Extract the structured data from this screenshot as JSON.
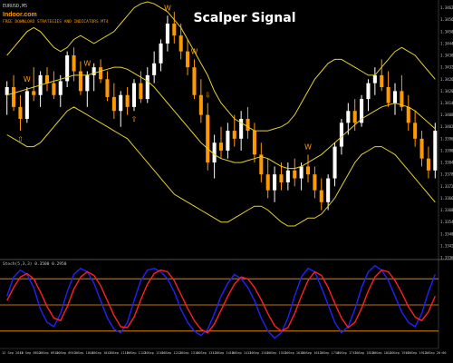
{
  "header": {
    "symbol_line": "EURUSD,M5",
    "brand": "Indoor.com",
    "subtitle": "FREE DOWNLOAD STRATEGIES AND INDICATORS MT4",
    "watermark": "Scalper Signal"
  },
  "indicator": {
    "label": "Stoch(5,3,3) 0.3500 0.2950"
  },
  "colors": {
    "background": "#000000",
    "bull_candle": "#ffffff",
    "bear_candle": "#ff9900",
    "band": "#e6cf2f",
    "arrow_label": "#ff9900",
    "signal_up": "#22cc22",
    "stoch_main": "#2222ff",
    "stoch_signal": "#ff2020",
    "stoch_level": "#ff9900",
    "axis_text": "#c8c8c8"
  },
  "chart_data": {
    "type": "candlestick",
    "price_axis_labels": [
      "1.3462",
      "1.3456",
      "1.3450",
      "1.3444",
      "1.3438",
      "1.3432",
      "1.3426",
      "1.3420",
      "1.3414",
      "1.3408",
      "1.3402",
      "1.3396",
      "1.3390",
      "1.3384",
      "1.3378",
      "1.3372",
      "1.3366",
      "1.3360",
      "1.3354",
      "1.3348",
      "1.3342",
      "1.3336"
    ],
    "time_axis_labels": [
      "12 Sep 2016",
      "12 Sep 08:30",
      "12 Sep 09:00",
      "12 Sep 09:30",
      "12 Sep 10:00",
      "12 Sep 10:30",
      "12 Sep 11:00",
      "12 Sep 11:30",
      "12 Sep 12:00",
      "12 Sep 12:30",
      "12 Sep 13:00",
      "12 Sep 13:30",
      "12 Sep 14:00",
      "12 Sep 14:30",
      "12 Sep 15:00",
      "12 Sep 15:30",
      "12 Sep 16:00",
      "12 Sep 16:30",
      "12 Sep 17:00",
      "12 Sep 17:30",
      "12 Sep 18:00",
      "12 Sep 18:30",
      "12 Sep 19:00",
      "12 Sep 19:30",
      "12 Sep 20:00"
    ],
    "price_range": [
      1.3336,
      1.3465
    ],
    "candles": [
      {
        "o": 1.3418,
        "h": 1.3425,
        "l": 1.3408,
        "c": 1.3422
      },
      {
        "o": 1.3422,
        "h": 1.3428,
        "l": 1.341,
        "c": 1.3412
      },
      {
        "o": 1.3412,
        "h": 1.3418,
        "l": 1.34,
        "c": 1.3406
      },
      {
        "o": 1.3406,
        "h": 1.3422,
        "l": 1.3404,
        "c": 1.342
      },
      {
        "o": 1.342,
        "h": 1.3432,
        "l": 1.3415,
        "c": 1.3418
      },
      {
        "o": 1.3418,
        "h": 1.343,
        "l": 1.3412,
        "c": 1.3428
      },
      {
        "o": 1.3428,
        "h": 1.3432,
        "l": 1.342,
        "c": 1.3424
      },
      {
        "o": 1.3424,
        "h": 1.343,
        "l": 1.3416,
        "c": 1.3418
      },
      {
        "o": 1.3418,
        "h": 1.3428,
        "l": 1.3412,
        "c": 1.3425
      },
      {
        "o": 1.3425,
        "h": 1.344,
        "l": 1.3422,
        "c": 1.3438
      },
      {
        "o": 1.3438,
        "h": 1.3442,
        "l": 1.3425,
        "c": 1.343
      },
      {
        "o": 1.343,
        "h": 1.3435,
        "l": 1.3418,
        "c": 1.342
      },
      {
        "o": 1.342,
        "h": 1.343,
        "l": 1.3412,
        "c": 1.3428
      },
      {
        "o": 1.3428,
        "h": 1.3434,
        "l": 1.342,
        "c": 1.3432
      },
      {
        "o": 1.3432,
        "h": 1.3436,
        "l": 1.3424,
        "c": 1.3426
      },
      {
        "o": 1.3426,
        "h": 1.343,
        "l": 1.3415,
        "c": 1.3417
      },
      {
        "o": 1.3417,
        "h": 1.3424,
        "l": 1.3406,
        "c": 1.341
      },
      {
        "o": 1.341,
        "h": 1.342,
        "l": 1.3402,
        "c": 1.3418
      },
      {
        "o": 1.3418,
        "h": 1.3422,
        "l": 1.3408,
        "c": 1.3412
      },
      {
        "o": 1.3412,
        "h": 1.3426,
        "l": 1.341,
        "c": 1.3424
      },
      {
        "o": 1.3424,
        "h": 1.343,
        "l": 1.3414,
        "c": 1.3416
      },
      {
        "o": 1.3416,
        "h": 1.3432,
        "l": 1.3414,
        "c": 1.3428
      },
      {
        "o": 1.3428,
        "h": 1.344,
        "l": 1.3424,
        "c": 1.3434
      },
      {
        "o": 1.3434,
        "h": 1.3446,
        "l": 1.343,
        "c": 1.3444
      },
      {
        "o": 1.3444,
        "h": 1.3458,
        "l": 1.344,
        "c": 1.3454
      },
      {
        "o": 1.3454,
        "h": 1.346,
        "l": 1.3444,
        "c": 1.3448
      },
      {
        "o": 1.3448,
        "h": 1.3454,
        "l": 1.3436,
        "c": 1.344
      },
      {
        "o": 1.344,
        "h": 1.3446,
        "l": 1.3428,
        "c": 1.3432
      },
      {
        "o": 1.3432,
        "h": 1.3436,
        "l": 1.3416,
        "c": 1.3418
      },
      {
        "o": 1.3418,
        "h": 1.3426,
        "l": 1.3404,
        "c": 1.3408
      },
      {
        "o": 1.3408,
        "h": 1.3414,
        "l": 1.338,
        "c": 1.3384
      },
      {
        "o": 1.3384,
        "h": 1.3398,
        "l": 1.3376,
        "c": 1.3394
      },
      {
        "o": 1.3394,
        "h": 1.3402,
        "l": 1.3386,
        "c": 1.339
      },
      {
        "o": 1.339,
        "h": 1.3404,
        "l": 1.3386,
        "c": 1.34
      },
      {
        "o": 1.34,
        "h": 1.3408,
        "l": 1.3392,
        "c": 1.3396
      },
      {
        "o": 1.3396,
        "h": 1.341,
        "l": 1.339,
        "c": 1.3406
      },
      {
        "o": 1.3406,
        "h": 1.3412,
        "l": 1.3396,
        "c": 1.34
      },
      {
        "o": 1.34,
        "h": 1.3404,
        "l": 1.3384,
        "c": 1.3388
      },
      {
        "o": 1.3388,
        "h": 1.3394,
        "l": 1.3374,
        "c": 1.3378
      },
      {
        "o": 1.3378,
        "h": 1.3386,
        "l": 1.3366,
        "c": 1.337
      },
      {
        "o": 1.337,
        "h": 1.3382,
        "l": 1.3364,
        "c": 1.3378
      },
      {
        "o": 1.3378,
        "h": 1.3384,
        "l": 1.337,
        "c": 1.3374
      },
      {
        "o": 1.3374,
        "h": 1.3384,
        "l": 1.337,
        "c": 1.338
      },
      {
        "o": 1.338,
        "h": 1.3386,
        "l": 1.3372,
        "c": 1.3376
      },
      {
        "o": 1.3376,
        "h": 1.3384,
        "l": 1.337,
        "c": 1.3382
      },
      {
        "o": 1.3382,
        "h": 1.3388,
        "l": 1.3374,
        "c": 1.3378
      },
      {
        "o": 1.3378,
        "h": 1.3382,
        "l": 1.3366,
        "c": 1.337
      },
      {
        "o": 1.337,
        "h": 1.3376,
        "l": 1.336,
        "c": 1.3364
      },
      {
        "o": 1.3364,
        "h": 1.3378,
        "l": 1.336,
        "c": 1.3376
      },
      {
        "o": 1.3376,
        "h": 1.3394,
        "l": 1.3372,
        "c": 1.3392
      },
      {
        "o": 1.3392,
        "h": 1.3406,
        "l": 1.3388,
        "c": 1.3404
      },
      {
        "o": 1.3404,
        "h": 1.3414,
        "l": 1.3398,
        "c": 1.341
      },
      {
        "o": 1.341,
        "h": 1.3416,
        "l": 1.34,
        "c": 1.3404
      },
      {
        "o": 1.3404,
        "h": 1.3418,
        "l": 1.3402,
        "c": 1.3416
      },
      {
        "o": 1.3416,
        "h": 1.3426,
        "l": 1.341,
        "c": 1.3424
      },
      {
        "o": 1.3424,
        "h": 1.3432,
        "l": 1.3418,
        "c": 1.3428
      },
      {
        "o": 1.3428,
        "h": 1.3436,
        "l": 1.342,
        "c": 1.3422
      },
      {
        "o": 1.3422,
        "h": 1.343,
        "l": 1.3412,
        "c": 1.3414
      },
      {
        "o": 1.3414,
        "h": 1.3424,
        "l": 1.3408,
        "c": 1.342
      },
      {
        "o": 1.342,
        "h": 1.3428,
        "l": 1.341,
        "c": 1.3412
      },
      {
        "o": 1.3412,
        "h": 1.3418,
        "l": 1.34,
        "c": 1.3404
      },
      {
        "o": 1.3404,
        "h": 1.341,
        "l": 1.3392,
        "c": 1.3396
      },
      {
        "o": 1.3396,
        "h": 1.34,
        "l": 1.3382,
        "c": 1.3386
      },
      {
        "o": 1.3386,
        "h": 1.3392,
        "l": 1.3376,
        "c": 1.338
      },
      {
        "o": 1.338,
        "h": 1.3404,
        "l": 1.3376,
        "c": 1.34
      }
    ],
    "bollinger": {
      "upper": [
        1.3438,
        1.3442,
        1.3446,
        1.345,
        1.3452,
        1.345,
        1.3446,
        1.3442,
        1.344,
        1.3442,
        1.3446,
        1.3448,
        1.3446,
        1.3444,
        1.3446,
        1.3448,
        1.345,
        1.3454,
        1.3458,
        1.3462,
        1.3464,
        1.3465,
        1.3464,
        1.3462,
        1.346,
        1.3456,
        1.3452,
        1.3446,
        1.344,
        1.3434,
        1.3428,
        1.342,
        1.3414,
        1.341,
        1.3406,
        1.3404,
        1.3402,
        1.34,
        1.34,
        1.34,
        1.3401,
        1.3402,
        1.3404,
        1.3408,
        1.3414,
        1.342,
        1.3426,
        1.343,
        1.3434,
        1.3436,
        1.3436,
        1.3434,
        1.3432,
        1.343,
        1.3428,
        1.3428,
        1.3432,
        1.3436,
        1.344,
        1.3442,
        1.344,
        1.3438,
        1.3434,
        1.343,
        1.3426
      ],
      "middle": [
        1.3418,
        1.3419,
        1.342,
        1.3421,
        1.3422,
        1.3423,
        1.3424,
        1.3425,
        1.3426,
        1.3427,
        1.3428,
        1.3428,
        1.3428,
        1.3429,
        1.343,
        1.3431,
        1.3432,
        1.3432,
        1.3431,
        1.3429,
        1.3427,
        1.3425,
        1.3422,
        1.3418,
        1.3414,
        1.341,
        1.3406,
        1.3402,
        1.3398,
        1.3394,
        1.3391,
        1.3388,
        1.3386,
        1.3385,
        1.3384,
        1.3384,
        1.3385,
        1.3386,
        1.3387,
        1.3386,
        1.3384,
        1.3382,
        1.3381,
        1.3381,
        1.3382,
        1.3384,
        1.3386,
        1.3388,
        1.3391,
        1.3394,
        1.3397,
        1.34,
        1.3403,
        1.3406,
        1.3408,
        1.341,
        1.3412,
        1.3413,
        1.3414,
        1.3413,
        1.3412,
        1.341,
        1.3407,
        1.3404,
        1.3401
      ],
      "lower": [
        1.3398,
        1.3396,
        1.3394,
        1.3392,
        1.3392,
        1.3394,
        1.3398,
        1.3402,
        1.3406,
        1.341,
        1.3412,
        1.341,
        1.3408,
        1.3406,
        1.3404,
        1.3402,
        1.34,
        1.3398,
        1.3396,
        1.3392,
        1.3388,
        1.3384,
        1.338,
        1.3376,
        1.3372,
        1.3368,
        1.3366,
        1.3364,
        1.3362,
        1.336,
        1.3358,
        1.3356,
        1.3354,
        1.3354,
        1.3356,
        1.3358,
        1.336,
        1.3362,
        1.3362,
        1.336,
        1.3357,
        1.3354,
        1.3352,
        1.3352,
        1.3354,
        1.3356,
        1.3356,
        1.3358,
        1.3362,
        1.3366,
        1.3372,
        1.3378,
        1.3384,
        1.3388,
        1.339,
        1.3392,
        1.3392,
        1.339,
        1.3388,
        1.3384,
        1.338,
        1.3376,
        1.3372,
        1.3368,
        1.3364
      ]
    },
    "signals": [
      {
        "index": 3,
        "label": "W",
        "kind": "down"
      },
      {
        "index": 12,
        "label": "W",
        "kind": "down"
      },
      {
        "index": 24,
        "label": "W",
        "kind": "down"
      },
      {
        "index": 28,
        "label": "W",
        "kind": "down"
      },
      {
        "index": 45,
        "label": "W",
        "kind": "down"
      },
      {
        "index": 2,
        "label": "⇧",
        "kind": "up"
      },
      {
        "index": 30,
        "label": "⇩",
        "kind": "down"
      },
      {
        "index": 19,
        "label": "⇧",
        "kind": "up"
      }
    ],
    "stochastic": {
      "range": [
        0,
        100
      ],
      "levels": [
        80,
        50,
        20
      ],
      "main": [
        60,
        82,
        90,
        85,
        70,
        45,
        30,
        25,
        40,
        65,
        85,
        92,
        88,
        75,
        55,
        35,
        22,
        18,
        30,
        55,
        78,
        90,
        92,
        88,
        80,
        65,
        45,
        30,
        20,
        15,
        22,
        40,
        60,
        75,
        85,
        80,
        70,
        55,
        35,
        20,
        12,
        18,
        35,
        60,
        82,
        92,
        88,
        70,
        50,
        30,
        18,
        25,
        45,
        70,
        88,
        95,
        90,
        78,
        60,
        42,
        30,
        25,
        40,
        65,
        85
      ],
      "signal": [
        55,
        70,
        82,
        86,
        80,
        65,
        48,
        35,
        32,
        48,
        68,
        82,
        88,
        84,
        72,
        55,
        38,
        25,
        24,
        36,
        56,
        74,
        86,
        90,
        88,
        78,
        62,
        46,
        32,
        22,
        18,
        28,
        44,
        60,
        74,
        82,
        80,
        70,
        56,
        40,
        26,
        20,
        24,
        40,
        60,
        78,
        88,
        84,
        70,
        52,
        35,
        24,
        30,
        46,
        66,
        82,
        90,
        88,
        78,
        64,
        48,
        36,
        32,
        42,
        60
      ]
    }
  }
}
